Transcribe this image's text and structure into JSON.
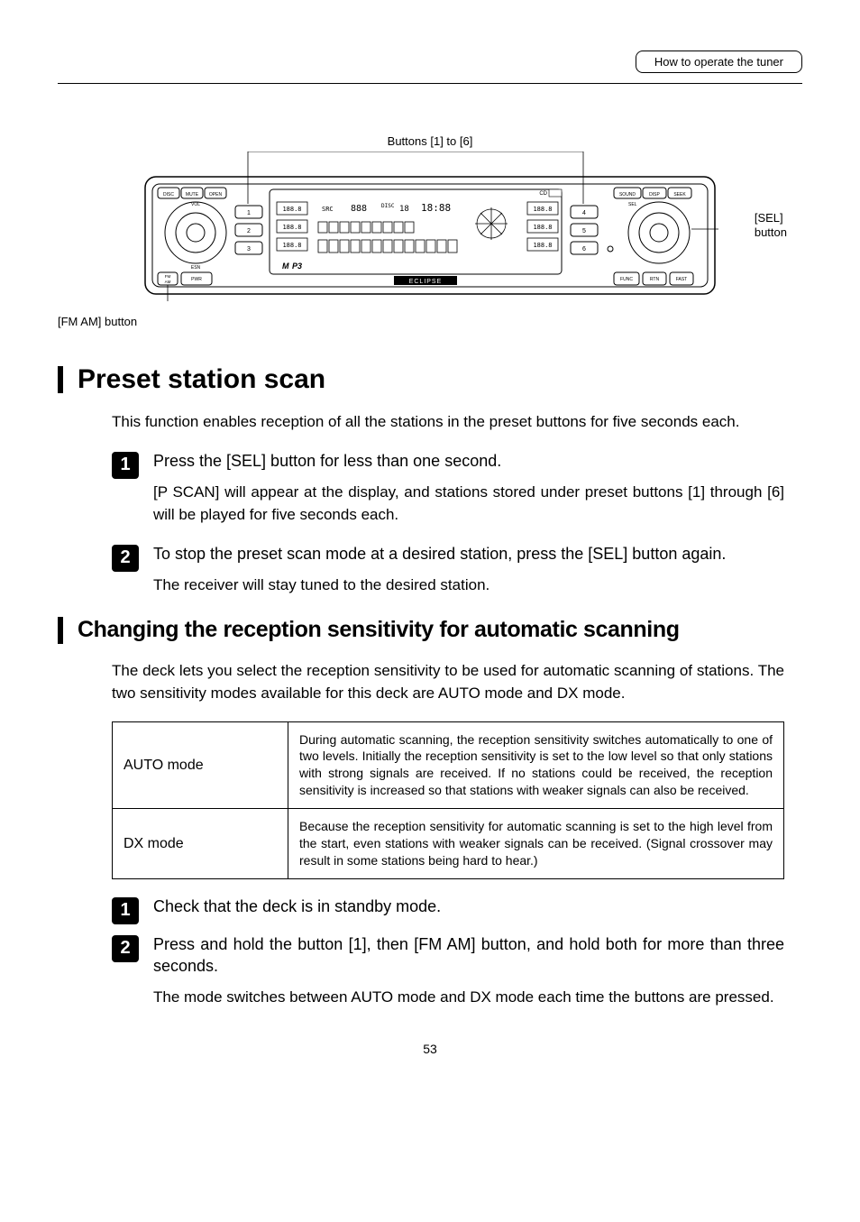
{
  "header": {
    "breadcrumb": "How to operate the tuner"
  },
  "figure": {
    "buttons_label": "Buttons [1] to [6]",
    "sel_label_line1": "[SEL]",
    "sel_label_line2": "button",
    "fmam_label": "[FM AM] button"
  },
  "section1": {
    "heading": "Preset station scan",
    "intro": "This function enables reception of all the stations in the preset buttons for five seconds each.",
    "steps": [
      {
        "num": "1",
        "title": "Press the [SEL] button for less than one second.",
        "desc": "[P SCAN] will appear at the display, and stations stored under preset buttons [1] through [6] will be played for five seconds each."
      },
      {
        "num": "2",
        "title": "To stop the preset scan mode at a desired station, press the [SEL] button again.",
        "desc": "The receiver will stay tuned to the desired station."
      }
    ]
  },
  "section2": {
    "heading": "Changing the reception sensitivity for automatic scanning",
    "intro": "The deck lets you select the reception sensitivity to be used for automatic scanning of stations. The two sensitivity modes available for this deck are AUTO mode and DX mode.",
    "table": [
      {
        "name": "AUTO mode",
        "desc": "During automatic scanning, the reception sensitivity switches automatically to one of two levels. Initially the reception sensitivity is set to the low level so that only stations with strong signals are received. If no stations could be received, the reception sensitivity is increased so that stations with weaker signals can also be received."
      },
      {
        "name": "DX mode",
        "desc": "Because the reception sensitivity for automatic scanning is set to the high level from the start, even stations with weaker signals can be received. (Signal crossover may result in some stations being hard to hear.)"
      }
    ],
    "steps": [
      {
        "num": "1",
        "title": "Check that the deck is in standby mode.",
        "desc": ""
      },
      {
        "num": "2",
        "title": "Press and hold the button [1], then [FM AM] button, and hold both for more than three seconds.",
        "desc": "The mode switches between AUTO mode and DX mode each time the buttons are pressed."
      }
    ]
  },
  "page_number": "53"
}
